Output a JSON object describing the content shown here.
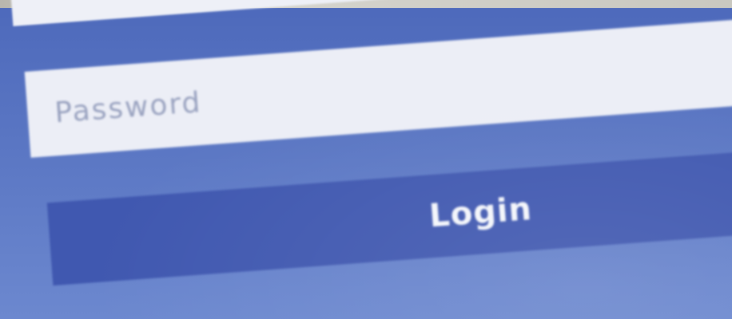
{
  "login_form": {
    "password": {
      "placeholder": "Password",
      "value": ""
    },
    "login_button": {
      "label": "Login"
    }
  },
  "colors": {
    "background": "#5b76c2",
    "input_background": "#eceef6",
    "button_background": "#4058b0",
    "button_text": "#f4f6fb",
    "placeholder_text": "#9aa3c0"
  }
}
